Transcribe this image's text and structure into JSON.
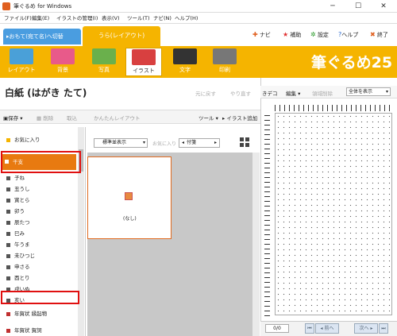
{
  "window": {
    "title": "筆ぐるめ for Windows",
    "min": "─",
    "max": "☐",
    "close": "✕"
  },
  "menu": [
    "ファイル(F)",
    "編集(E)",
    "イラストの管理(I)",
    "表示(V)",
    "ツール(T)",
    "ナビ(N)",
    "ヘルプ(H)"
  ],
  "tabs": {
    "omote": "▸おもて(宛て名)へ切替",
    "ura": "うら(レイアウト)"
  },
  "top_links": {
    "navi": "ナビ",
    "help_assist": "補助",
    "settings": "設定",
    "help": "ヘルプ",
    "exit": "終了"
  },
  "tools": [
    "レイアウト",
    "背景",
    "写真",
    "イラスト",
    "文字",
    "印刷"
  ],
  "brand": "筆ぐるめ25",
  "paper_title": "白紙 (はがき たて)",
  "undo": "元に戻す",
  "redo": "やり直す",
  "actions": {
    "save": "保存",
    "delete": "削除",
    "import": "取込",
    "simple_layout": "かんたんレイアウト",
    "tool": "ツール",
    "add_illust": "イラスト追加"
  },
  "categories": [
    "お気に入り",
    "干支",
    "子ね",
    "丑うし",
    "寅とら",
    "卯う",
    "辰たつ",
    "巳み",
    "午うま",
    "未ひつじ",
    "申さる",
    "酉とり",
    "戌いぬ",
    "亥い",
    "年賀状 縁起物",
    "年賀状 賀詞"
  ],
  "middle": {
    "sort": "標準並表示",
    "favorite": "お気に入り",
    "nav_label": "付箋",
    "thumb_label": "(なし)"
  },
  "right": {
    "tab": "きデコ",
    "edit": "編集",
    "area_delete": "領域削除",
    "display": "全体を表示"
  },
  "bottom": {
    "page": "0/0",
    "prev": "◂ 前へ",
    "next": "次へ ▸"
  },
  "colors": {
    "accent": "#f5b400",
    "tab_blue": "#4a9de0",
    "highlight": "#e01010",
    "selected": "#e87a10"
  }
}
